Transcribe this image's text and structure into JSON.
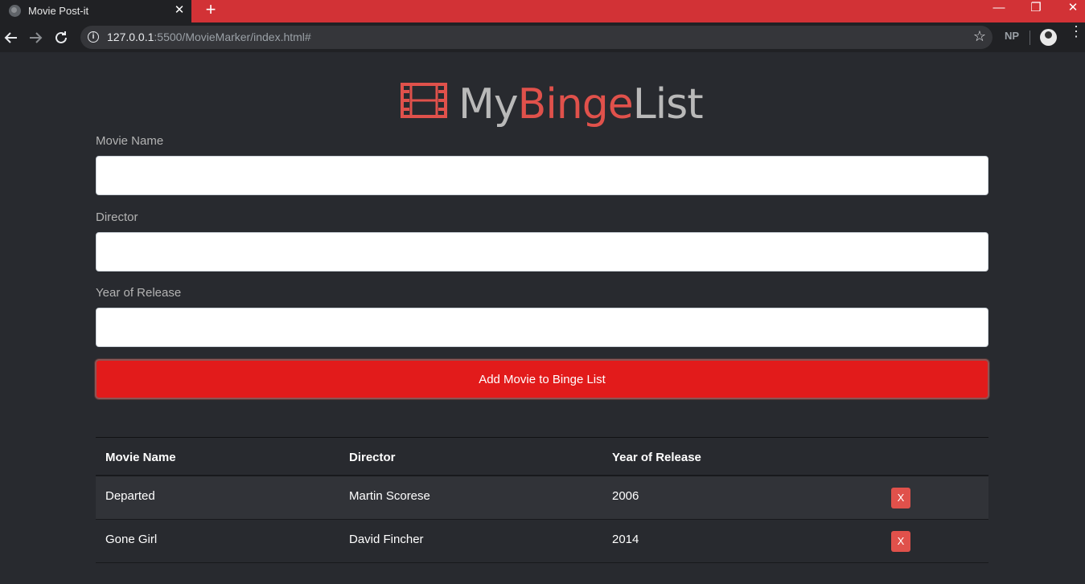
{
  "browser": {
    "tab_title": "Movie Post-it",
    "tab_close": "✕",
    "new_tab": "+",
    "url_host": "127.0.0.1",
    "url_rest": ":5500/MovieMarker/index.html#",
    "profile_initials": "NP",
    "minimize": "—",
    "restore": "❐",
    "close": "✕"
  },
  "brand": {
    "part1": "My",
    "part2": "Binge",
    "part3": "List",
    "accent_color": "#e0514b",
    "icon": "film-icon"
  },
  "form": {
    "movie_label": "Movie Name",
    "director_label": "Director",
    "year_label": "Year of Release",
    "movie_value": "",
    "director_value": "",
    "year_value": "",
    "submit_label": "Add Movie to Binge List"
  },
  "table": {
    "headers": [
      "Movie Name",
      "Director",
      "Year of Release"
    ],
    "rows": [
      {
        "name": "Departed",
        "director": "Martin Scorese",
        "year": "2006",
        "delete": "X"
      },
      {
        "name": "Gone Girl",
        "director": "David Fincher",
        "year": "2014",
        "delete": "X"
      }
    ]
  }
}
